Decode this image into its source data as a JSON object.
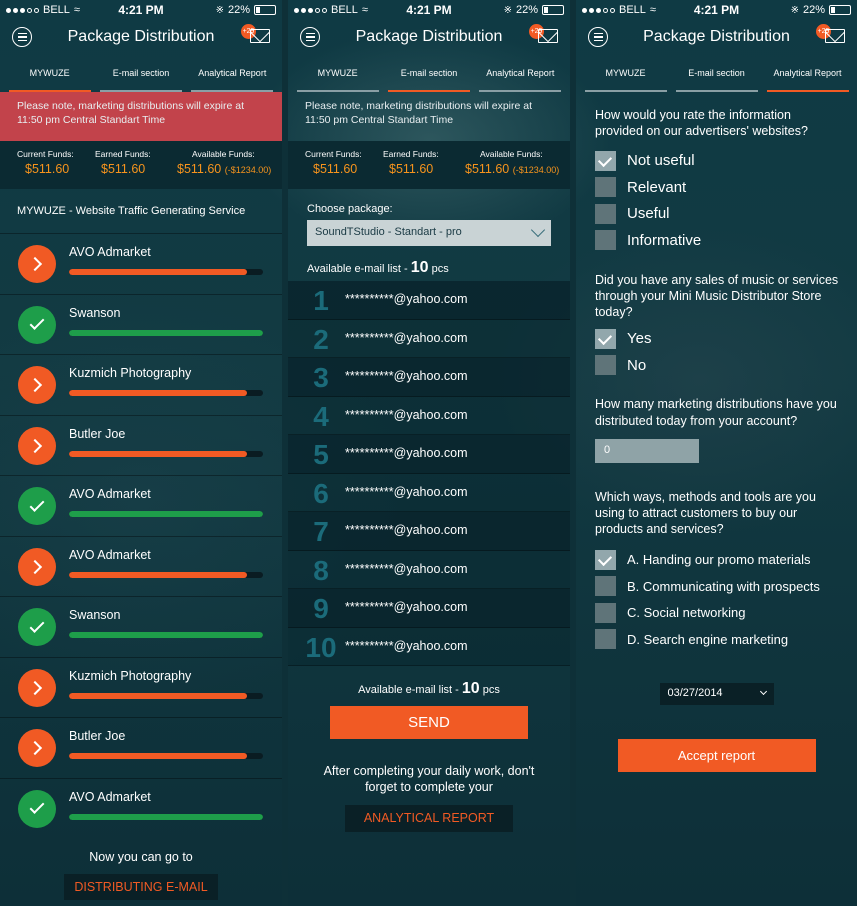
{
  "status": {
    "carrier": "BELL",
    "time": "4:21 PM",
    "battery": "22%"
  },
  "header": {
    "title": "Package Distribution",
    "badge": "+29"
  },
  "tabs": [
    "MYWUZE",
    "E-mail section",
    "Analytical Report"
  ],
  "notice": "Please note, marketing distributions will expire at 11:50 pm Central Standart Time",
  "funds": {
    "current_label": "Current Funds:",
    "current_value": "$511.60",
    "earned_label": "Earned Funds:",
    "earned_value": "$511.60",
    "available_label": "Available Funds:",
    "available_value": "$511.60",
    "available_extra": "(-$1234.00)"
  },
  "panel1": {
    "service_title": "MYWUZE - Website Traffic Generating Service",
    "rows": [
      {
        "name": "AVO Admarket",
        "status": "pending",
        "progress": 0.92
      },
      {
        "name": "Swanson",
        "status": "done",
        "progress": 1.0
      },
      {
        "name": "Kuzmich Photography",
        "status": "pending",
        "progress": 0.92
      },
      {
        "name": "Butler Joe",
        "status": "pending",
        "progress": 0.92
      },
      {
        "name": "AVO Admarket",
        "status": "done",
        "progress": 1.0
      },
      {
        "name": "AVO Admarket",
        "status": "pending",
        "progress": 0.92
      },
      {
        "name": "Swanson",
        "status": "done",
        "progress": 1.0
      },
      {
        "name": "Kuzmich Photography",
        "status": "pending",
        "progress": 0.92
      },
      {
        "name": "Butler Joe",
        "status": "pending",
        "progress": 0.92
      },
      {
        "name": "AVO Admarket",
        "status": "done",
        "progress": 1.0
      }
    ],
    "goto_text": "Now you can go to",
    "goto_button": "DISTRIBUTING E-MAIL"
  },
  "panel2": {
    "choose_label": "Choose package:",
    "package_value": "SoundTStudio - Standart - pro",
    "avail_label": "Available e-mail list - ",
    "avail_count": "10",
    "avail_unit": " pcs",
    "emails": [
      {
        "n": "1",
        "email": "**********@yahoo.com"
      },
      {
        "n": "2",
        "email": "**********@yahoo.com"
      },
      {
        "n": "3",
        "email": "**********@yahoo.com"
      },
      {
        "n": "4",
        "email": "**********@yahoo.com"
      },
      {
        "n": "5",
        "email": "**********@yahoo.com"
      },
      {
        "n": "6",
        "email": "**********@yahoo.com"
      },
      {
        "n": "7",
        "email": "**********@yahoo.com"
      },
      {
        "n": "8",
        "email": "**********@yahoo.com"
      },
      {
        "n": "9",
        "email": "**********@yahoo.com"
      },
      {
        "n": "10",
        "email": "**********@yahoo.com"
      }
    ],
    "send_button": "SEND",
    "after_text": "After completing your daily work, don't forget to complete your",
    "analytical_button": "ANALYTICAL REPORT"
  },
  "panel3": {
    "q1": "How would you rate the information provided on our advertisers' websites?",
    "q1_options": [
      {
        "label": "Not useful",
        "checked": true
      },
      {
        "label": "Relevant",
        "checked": false
      },
      {
        "label": "Useful",
        "checked": false
      },
      {
        "label": "Informative",
        "checked": false
      }
    ],
    "q2": "Did you have any sales of music or services through your Mini Music Distributor Store today?",
    "q2_options": [
      {
        "label": "Yes",
        "checked": true
      },
      {
        "label": "No",
        "checked": false
      }
    ],
    "q3": "How many marketing distributions have you distributed today from your account?",
    "q3_value": "0",
    "q4": "Which ways, methods and tools are you using to attract customers to buy our products and services?",
    "q4_options": [
      {
        "label": "A. Handing our promo materials",
        "checked": true
      },
      {
        "label": "B. Communicating with prospects",
        "checked": false
      },
      {
        "label": "C. Social networking",
        "checked": false
      },
      {
        "label": "D. Search engine marketing",
        "checked": false
      }
    ],
    "date": "03/27/2014",
    "accept_button": "Accept report"
  },
  "colors": {
    "accent": "#f15a24",
    "success": "#1e9e4a",
    "alert": "#c2434b",
    "funds": "#f7941d"
  }
}
